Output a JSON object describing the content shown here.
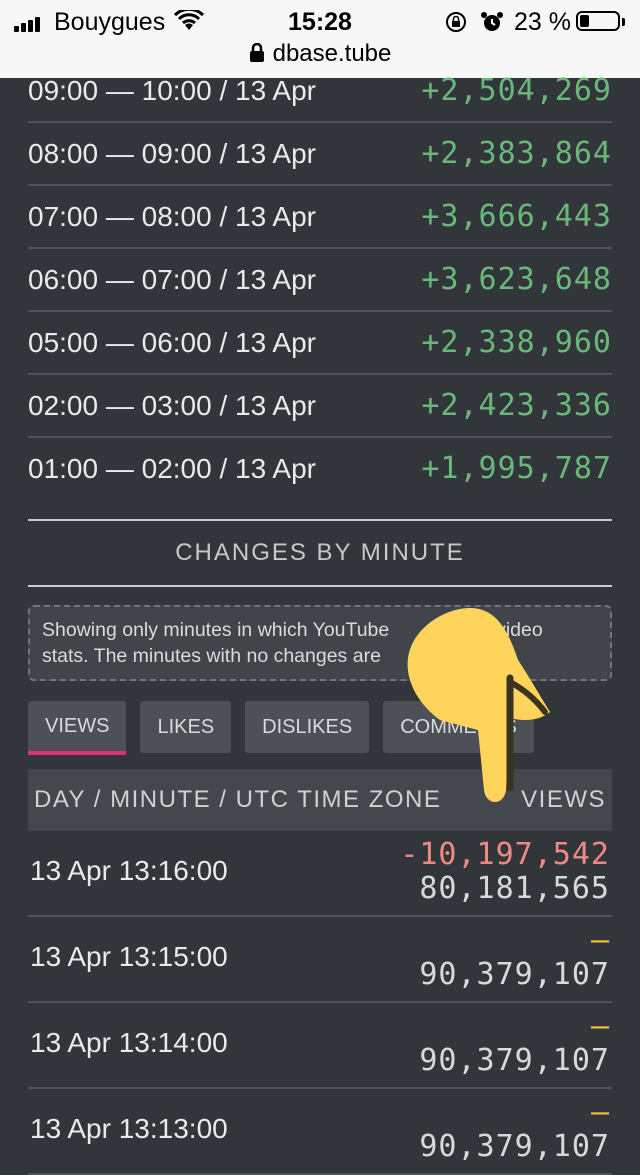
{
  "status_bar": {
    "carrier": "Bouygues",
    "time": "15:28",
    "battery_percent": "23 %",
    "battery_level": 0.23,
    "url": "dbase.tube"
  },
  "hourly_rows": [
    {
      "range": "09:00 — 10:00 / 13 Apr",
      "delta": "+2,504,269"
    },
    {
      "range": "08:00 — 09:00 / 13 Apr",
      "delta": "+2,383,864"
    },
    {
      "range": "07:00 — 08:00 / 13 Apr",
      "delta": "+3,666,443"
    },
    {
      "range": "06:00 — 07:00 / 13 Apr",
      "delta": "+3,623,648"
    },
    {
      "range": "05:00 — 06:00 / 13 Apr",
      "delta": "+2,338,960"
    },
    {
      "range": "02:00 — 03:00 / 13 Apr",
      "delta": "+2,423,336"
    },
    {
      "range": "01:00 — 02:00 / 13 Apr",
      "delta": "+1,995,787"
    }
  ],
  "section_title": "CHANGES BY MINUTE",
  "notice": {
    "line1": "Showing only minutes in which YouTube",
    "line1_end": "video",
    "line2": "stats. The minutes with no changes are"
  },
  "tabs": [
    {
      "label": "VIEWS",
      "active": true
    },
    {
      "label": "LIKES",
      "active": false
    },
    {
      "label": "DISLIKES",
      "active": false
    },
    {
      "label": "COMMENTS",
      "active": false
    }
  ],
  "table": {
    "col_left": "DAY / MINUTE / UTC TIME ZONE",
    "col_right": "VIEWS",
    "rows": [
      {
        "time": "13 Apr 13:16:00",
        "change": "-10,197,542",
        "total": "80,181,565",
        "kind": "neg"
      },
      {
        "time": "13 Apr 13:15:00",
        "change": "—",
        "total": "90,379,107",
        "kind": "none"
      },
      {
        "time": "13 Apr 13:14:00",
        "change": "—",
        "total": "90,379,107",
        "kind": "none"
      },
      {
        "time": "13 Apr 13:13:00",
        "change": "—",
        "total": "90,379,107",
        "kind": "none"
      }
    ]
  },
  "colors": {
    "positive": "#68b87a",
    "negative": "#ee8a86",
    "no_change": "#f0c23a",
    "active_tab_underline": "#e0306f",
    "hand_emoji": "#ffd45a"
  }
}
